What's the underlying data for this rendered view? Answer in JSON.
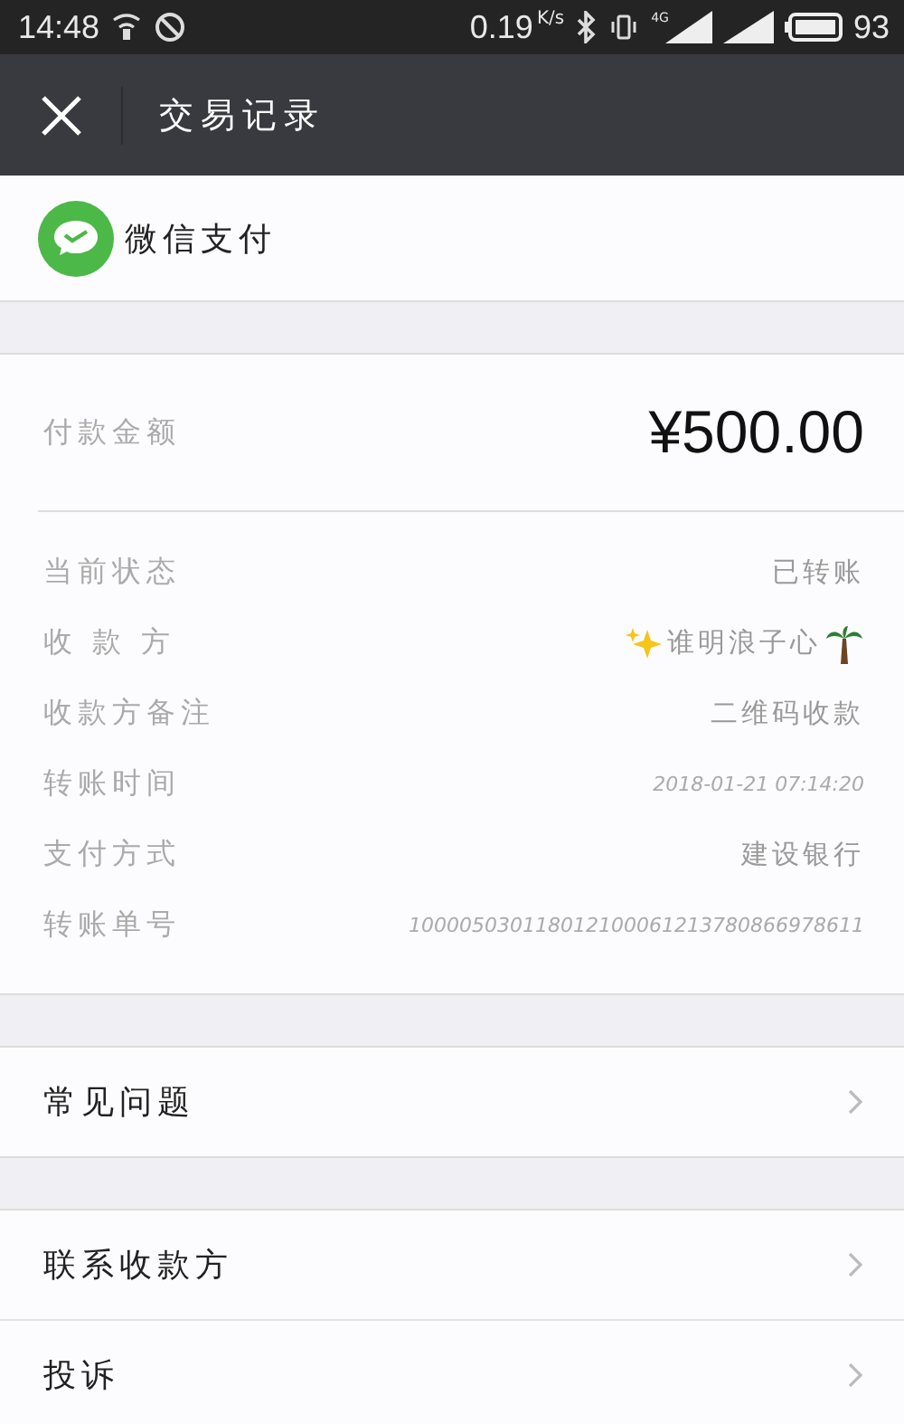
{
  "status_bar": {
    "time": "14:48",
    "speed": "0.19",
    "speed_unit": "K/s",
    "network": "4G",
    "battery": "93"
  },
  "header": {
    "title": "交易记录"
  },
  "brand": {
    "name": "微信支付"
  },
  "amount": {
    "label": "付款金额",
    "value": "¥500.00"
  },
  "details": [
    {
      "label": "当前状态",
      "value": "已转账",
      "kind": "text"
    },
    {
      "label": "收 款 方",
      "value": "谁明浪子心",
      "kind": "payee"
    },
    {
      "label": "收款方备注",
      "value": "二维码收款",
      "kind": "text"
    },
    {
      "label": "转账时间",
      "value": "2018-01-21 07:14:20",
      "kind": "small"
    },
    {
      "label": "支付方式",
      "value": "建设银行",
      "kind": "text"
    },
    {
      "label": "转账单号",
      "value": "100005030118012100061213780866978611",
      "kind": "small"
    }
  ],
  "menu_groups": [
    [
      "常见问题"
    ],
    [
      "联系收款方",
      "投诉"
    ]
  ]
}
